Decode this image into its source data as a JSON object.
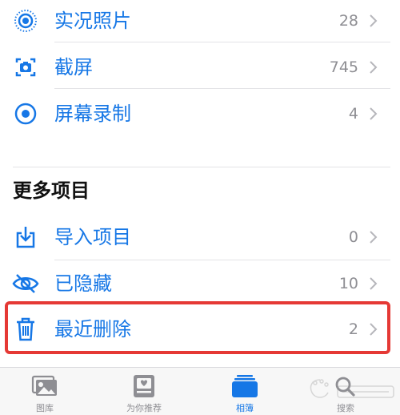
{
  "media_types": [
    {
      "label": "实况照片",
      "count": "28",
      "icon": "live-photos-icon"
    },
    {
      "label": "截屏",
      "count": "745",
      "icon": "screenshot-icon"
    },
    {
      "label": "屏幕录制",
      "count": "4",
      "icon": "screen-recording-icon"
    }
  ],
  "more_items": {
    "title": "更多项目",
    "items": [
      {
        "label": "导入项目",
        "count": "0",
        "icon": "import-icon"
      },
      {
        "label": "已隐藏",
        "count": "10",
        "icon": "hidden-eye-icon"
      },
      {
        "label": "最近删除",
        "count": "2",
        "icon": "trash-icon"
      }
    ]
  },
  "tab_bar": [
    {
      "label": "图库",
      "icon": "library-icon",
      "active": false
    },
    {
      "label": "为你推荐",
      "icon": "for-you-icon",
      "active": false
    },
    {
      "label": "相簿",
      "icon": "albums-icon",
      "active": true
    },
    {
      "label": "搜索",
      "icon": "search-icon",
      "active": false
    }
  ],
  "colors": {
    "accent": "#1677e6",
    "highlight": "#e53935",
    "secondary_text": "#8e8e93"
  }
}
